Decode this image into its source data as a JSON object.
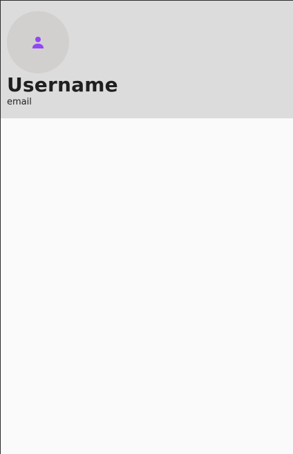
{
  "drawer_header": {
    "avatar_icon": "person-icon",
    "username": "Username",
    "email": "email"
  },
  "colors": {
    "header_background": "#dcdcdc",
    "avatar_background": "#d2cfcf",
    "accent": "#9047f5",
    "content_background": "#fafafa",
    "text_primary": "#1f1f1f"
  }
}
